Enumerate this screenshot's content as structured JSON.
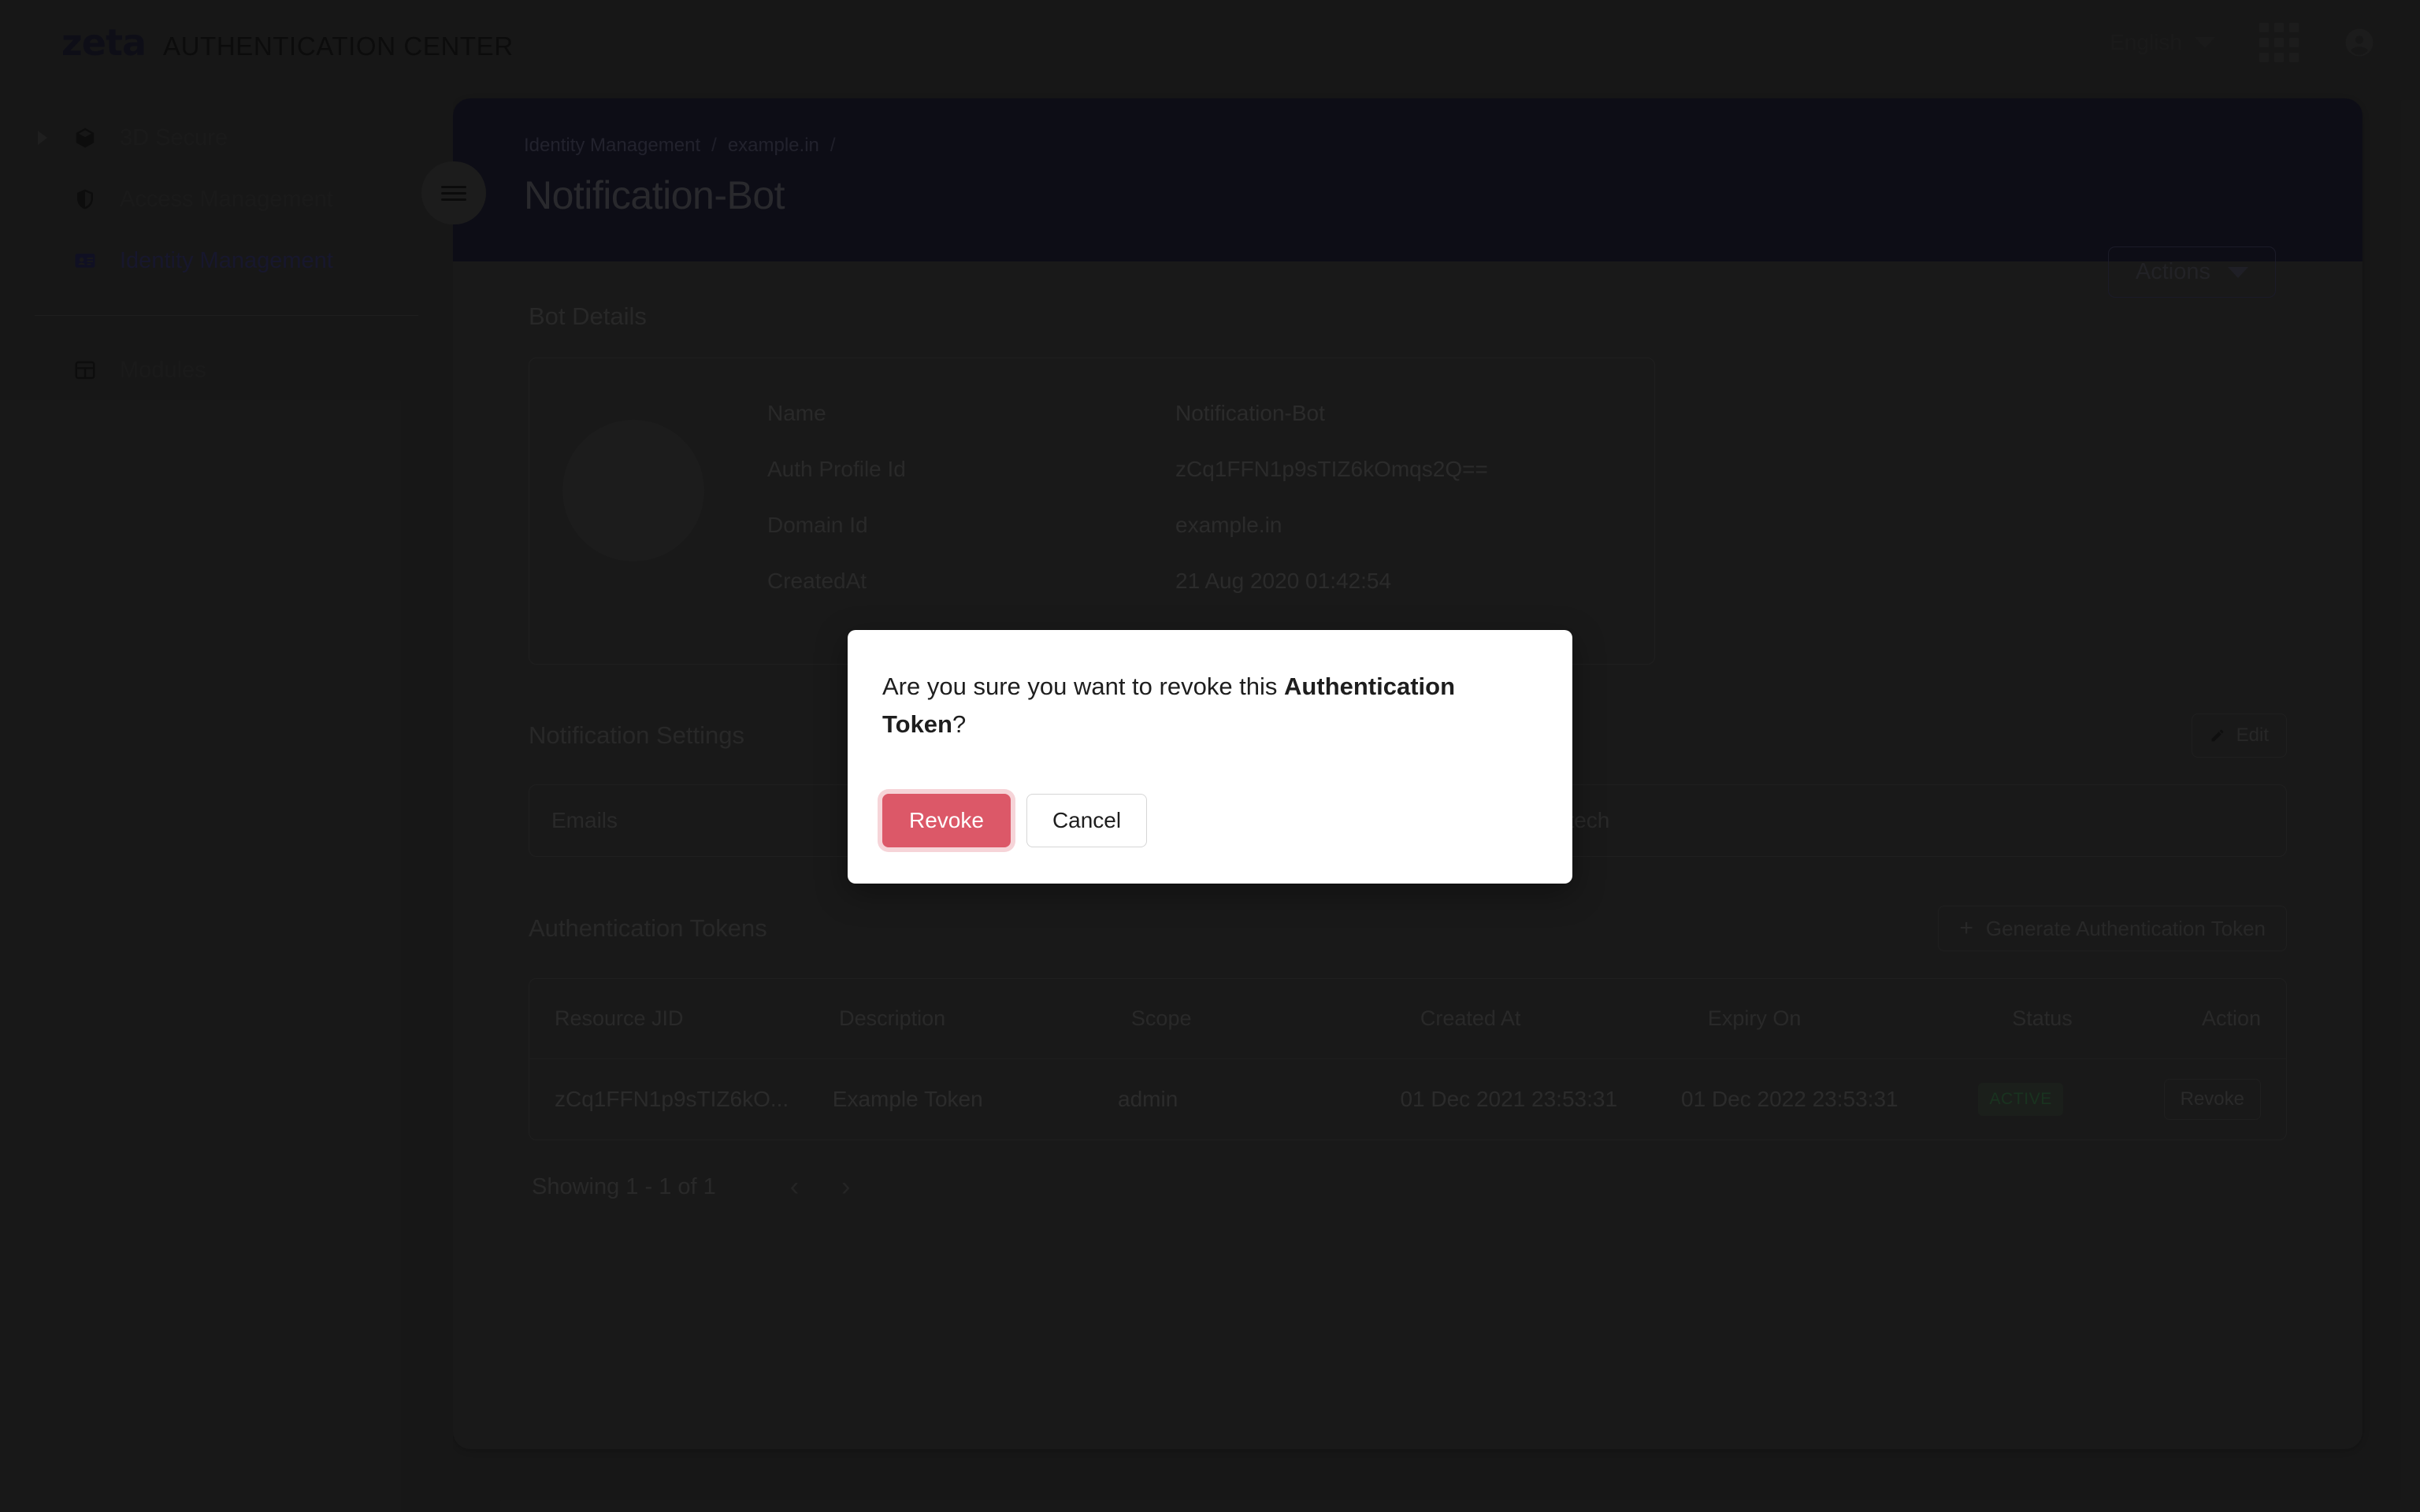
{
  "app": {
    "brand_logo": "zeta",
    "brand_subtitle": "AUTHENTICATION CENTER"
  },
  "topbar": {
    "language": "English",
    "apps_icon": "grid-apps-icon",
    "account_icon": "account-circle-icon"
  },
  "sidebar": {
    "items": [
      {
        "label": "3D Secure",
        "icon": "cube-icon",
        "expandable": true
      },
      {
        "label": "Access Management",
        "icon": "shield-icon",
        "expandable": false
      },
      {
        "label": "Identity Management",
        "icon": "id-card-icon",
        "expandable": false,
        "active": true
      },
      {
        "label": "Modules",
        "icon": "table-grid-icon",
        "expandable": false
      }
    ]
  },
  "banner": {
    "breadcrumb": [
      "Identity Management",
      "example.in",
      ""
    ],
    "title": "Notification-Bot",
    "actions_label": "Actions",
    "menu_toggle_icon": "hamburger-icon"
  },
  "bot_details": {
    "section_title": "Bot Details",
    "rows": [
      {
        "key": "Name",
        "value": "Notification-Bot"
      },
      {
        "key": "Auth Profile Id",
        "value": "zCq1FFN1p9sTIZ6kOmqs2Q=="
      },
      {
        "key": "Domain Id",
        "value": "example.in"
      },
      {
        "key": "CreatedAt",
        "value": "21 Aug 2020 01:42:54"
      }
    ]
  },
  "notification_settings": {
    "section_title": "Notification Settings",
    "edit_label": "Edit",
    "rows": [
      {
        "key": "Emails",
        "value": "admin@zeta.tech"
      }
    ]
  },
  "auth_tokens": {
    "section_title": "Authentication Tokens",
    "generate_label": "Generate Authentication Token",
    "columns": [
      "Resource JID",
      "Description",
      "Scope",
      "Created At",
      "Expiry On",
      "Status",
      "Action"
    ],
    "rows": [
      {
        "resource_jid": "zCq1FFN1p9sTIZ6kO...",
        "description": "Example Token",
        "scope": "admin",
        "created_at": "01 Dec 2021 23:53:31",
        "expiry_on": "01 Dec 2022 23:53:31",
        "status": "ACTIVE",
        "action": "Revoke"
      }
    ],
    "pagination": {
      "showing": "Showing  1 - 1  of  1",
      "prev_icon": "chevron-left-icon",
      "next_icon": "chevron-right-icon"
    }
  },
  "modal": {
    "question_prefix": "Are you sure you want to revoke this ",
    "question_bold": "Authentication Token",
    "question_suffix": "?",
    "confirm_label": "Revoke",
    "cancel_label": "Cancel",
    "confirm_color": "#dc5868"
  },
  "colors": {
    "page_background": "#2b2b2b",
    "card_background": "#2e2e2e",
    "banner_background": "#191929",
    "active_nav": "#2a2a52",
    "status_active": "#2f5d3a"
  }
}
